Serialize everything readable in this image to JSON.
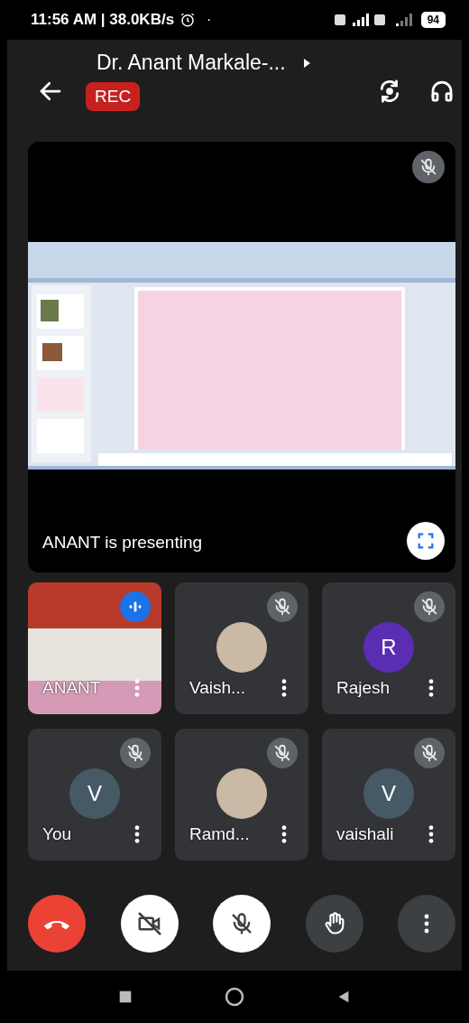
{
  "status_bar": {
    "time": "11:56 AM | 38.0KB/s",
    "dot": "·",
    "battery": "94"
  },
  "header": {
    "title": "Dr. Anant Markale-...",
    "rec_badge": "REC"
  },
  "presentation": {
    "muted": true,
    "caption": "ANANT is presenting"
  },
  "participants": [
    {
      "name": "ANANT",
      "kind": "video",
      "muted": false
    },
    {
      "name": "Vaish...",
      "kind": "photo",
      "muted": true
    },
    {
      "name": "Rajesh",
      "kind": "initial",
      "initial": "R",
      "color": "#5b2db3",
      "muted": true
    },
    {
      "name": "You",
      "kind": "initial",
      "initial": "V",
      "color": "#455a64",
      "muted": true
    },
    {
      "name": "Ramd...",
      "kind": "photo",
      "muted": true
    },
    {
      "name": "vaishali",
      "kind": "initial",
      "initial": "V",
      "color": "#455a64",
      "muted": true
    }
  ],
  "controls": {
    "camera_on": false,
    "mic_on": false
  }
}
